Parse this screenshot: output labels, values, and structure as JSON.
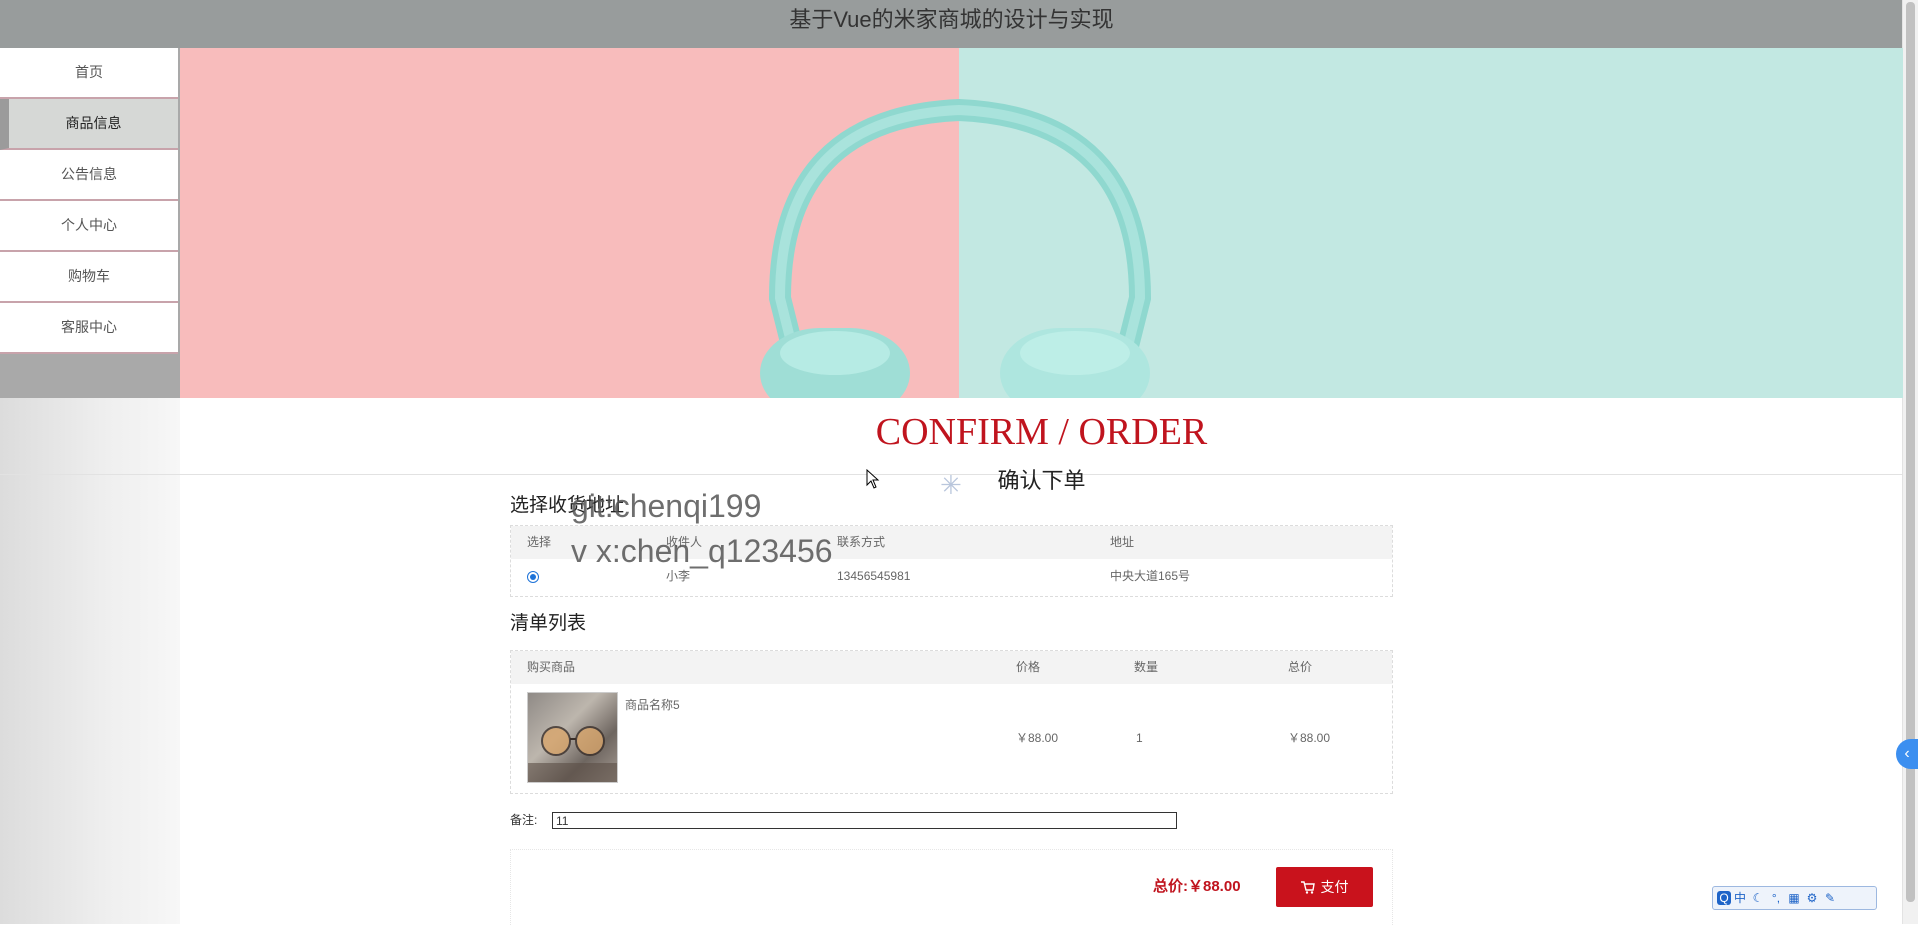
{
  "header": {
    "title": "基于Vue的米家商城的设计与实现"
  },
  "sidebar": {
    "items": [
      {
        "label": "首页"
      },
      {
        "label": "商品信息"
      },
      {
        "label": "公告信息"
      },
      {
        "label": "个人中心"
      },
      {
        "label": "购物车"
      },
      {
        "label": "客服中心"
      }
    ],
    "active_index": 1
  },
  "page": {
    "title_en": "CONFIRM / ORDER",
    "title_cn": "确认下单"
  },
  "watermark": {
    "line1": "git:chenqi199",
    "line2": "v x:chen_q123456"
  },
  "address": {
    "section_title": "选择收货地址",
    "columns": [
      "选择",
      "收件人",
      "联系方式",
      "地址"
    ],
    "rows": [
      {
        "selected": true,
        "recipient": "小李",
        "phone": "13456545981",
        "address": "中央大道165号"
      }
    ]
  },
  "order_list": {
    "section_title": "清单列表",
    "columns": [
      "购买商品",
      "价格",
      "数量",
      "总价"
    ],
    "rows": [
      {
        "name": "商品名称5",
        "price": "￥88.00",
        "quantity": "1",
        "total": "￥88.00",
        "image": "product-photo-glasses"
      }
    ]
  },
  "remark": {
    "label": "备注:",
    "value": "11"
  },
  "payment": {
    "total_label": "总价:",
    "total_value": "￥88.00",
    "pay_button": "支付",
    "pay_icon": "cart-icon"
  },
  "colors": {
    "accent_red": "#c9121c",
    "title_red": "#c0141e",
    "banner_pink": "#f8bcbc",
    "banner_mint": "#c2e8e2"
  },
  "ime_toolbar": {
    "label": "中"
  }
}
